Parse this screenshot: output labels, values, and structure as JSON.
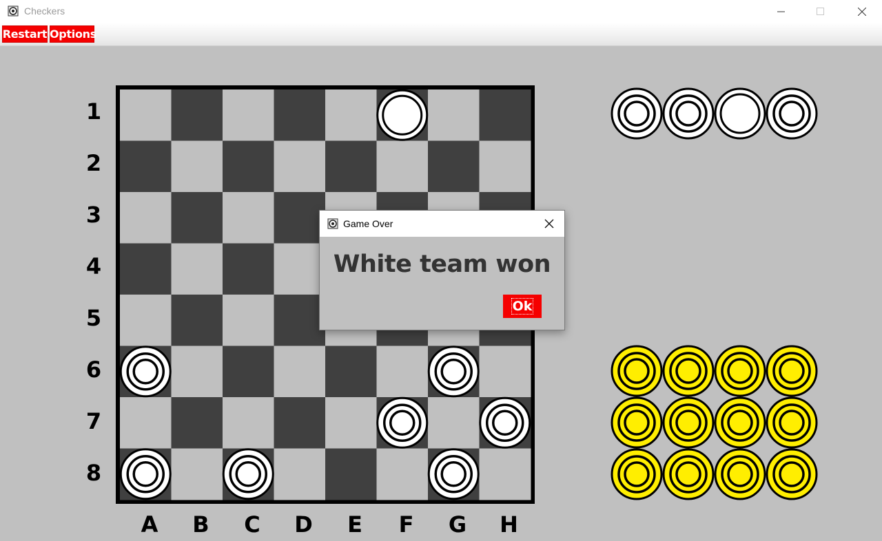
{
  "window": {
    "title": "Checkers"
  },
  "menu": {
    "restart_label": "Restart",
    "options_label": "Options"
  },
  "board": {
    "rows": [
      "1",
      "2",
      "3",
      "4",
      "5",
      "6",
      "7",
      "8"
    ],
    "columns": [
      "A",
      "B",
      "C",
      "D",
      "E",
      "F",
      "G",
      "H"
    ],
    "light_square": "#c0c0c0",
    "dark_square": "#404040",
    "pieces": [
      {
        "col": "F",
        "row": "1",
        "team": "white",
        "king": true
      },
      {
        "col": "A",
        "row": "6",
        "team": "white",
        "king": false
      },
      {
        "col": "G",
        "row": "6",
        "team": "white",
        "king": false
      },
      {
        "col": "F",
        "row": "7",
        "team": "white",
        "king": false
      },
      {
        "col": "H",
        "row": "7",
        "team": "white",
        "king": false
      },
      {
        "col": "A",
        "row": "8",
        "team": "white",
        "king": false
      },
      {
        "col": "C",
        "row": "8",
        "team": "white",
        "king": false
      },
      {
        "col": "G",
        "row": "8",
        "team": "white",
        "king": false
      }
    ]
  },
  "captured": {
    "white": [
      {
        "king": false
      },
      {
        "king": false
      },
      {
        "king": true
      },
      {
        "king": false
      }
    ],
    "yellow": [
      {
        "king": false
      },
      {
        "king": false
      },
      {
        "king": false
      },
      {
        "king": false
      },
      {
        "king": false
      },
      {
        "king": false
      },
      {
        "king": false
      },
      {
        "king": false
      },
      {
        "king": false
      },
      {
        "king": false
      },
      {
        "king": false
      },
      {
        "king": false
      }
    ]
  },
  "colors": {
    "white_piece": "#ffffff",
    "yellow_piece": "#ffee00",
    "menu_button": "#f50000"
  },
  "dialog": {
    "title": "Game Over",
    "message": "White team won",
    "ok_label": "Ok"
  }
}
